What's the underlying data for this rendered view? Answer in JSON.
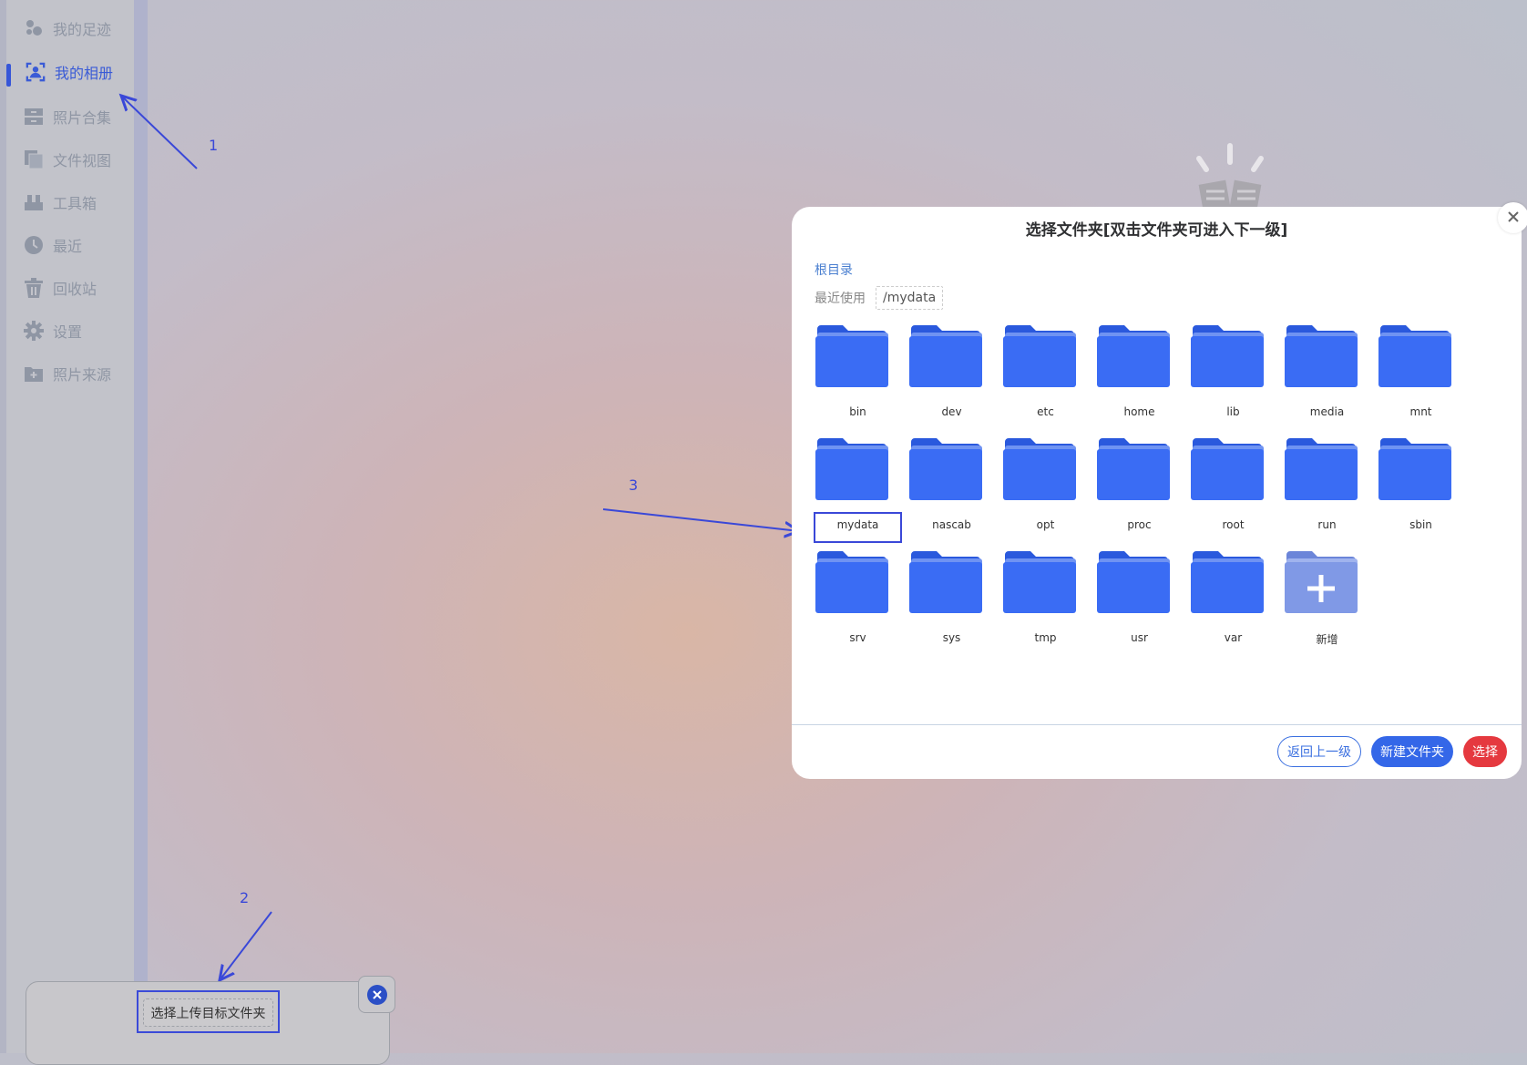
{
  "sidebar": {
    "items": [
      {
        "label": "我的足迹",
        "icon": "footprints-icon"
      },
      {
        "label": "我的相册",
        "icon": "person-frame-icon",
        "active": true
      },
      {
        "label": "照片合集",
        "icon": "collection-box-icon"
      },
      {
        "label": "文件视图",
        "icon": "files-copy-icon"
      },
      {
        "label": "工具箱",
        "icon": "toolbox-icon"
      },
      {
        "label": "最近",
        "icon": "clock-icon"
      },
      {
        "label": "回收站",
        "icon": "trash-icon"
      },
      {
        "label": "设置",
        "icon": "gear-icon"
      },
      {
        "label": "照片来源",
        "icon": "folder-plus-icon"
      }
    ]
  },
  "annotations": [
    "1",
    "2",
    "3"
  ],
  "upload_panel": {
    "button_label": "选择上传目标文件夹"
  },
  "dialog": {
    "title": "选择文件夹[双击文件夹可进入下一级]",
    "breadcrumb": "根目录",
    "recent_label": "最近使用",
    "recent_path": "/mydata",
    "folders": [
      "bin",
      "dev",
      "etc",
      "home",
      "lib",
      "media",
      "mnt",
      "mydata",
      "nascab",
      "opt",
      "proc",
      "root",
      "run",
      "sbin",
      "srv",
      "sys",
      "tmp",
      "usr",
      "var"
    ],
    "new_item_label": "新增",
    "buttons": {
      "back": "返回上一级",
      "new_folder": "新建文件夹",
      "select": "选择"
    }
  },
  "colors": {
    "accent": "#3467e8",
    "danger": "#e5393f",
    "folder": "#3a6cf4",
    "annotation": "#3a48d8"
  }
}
